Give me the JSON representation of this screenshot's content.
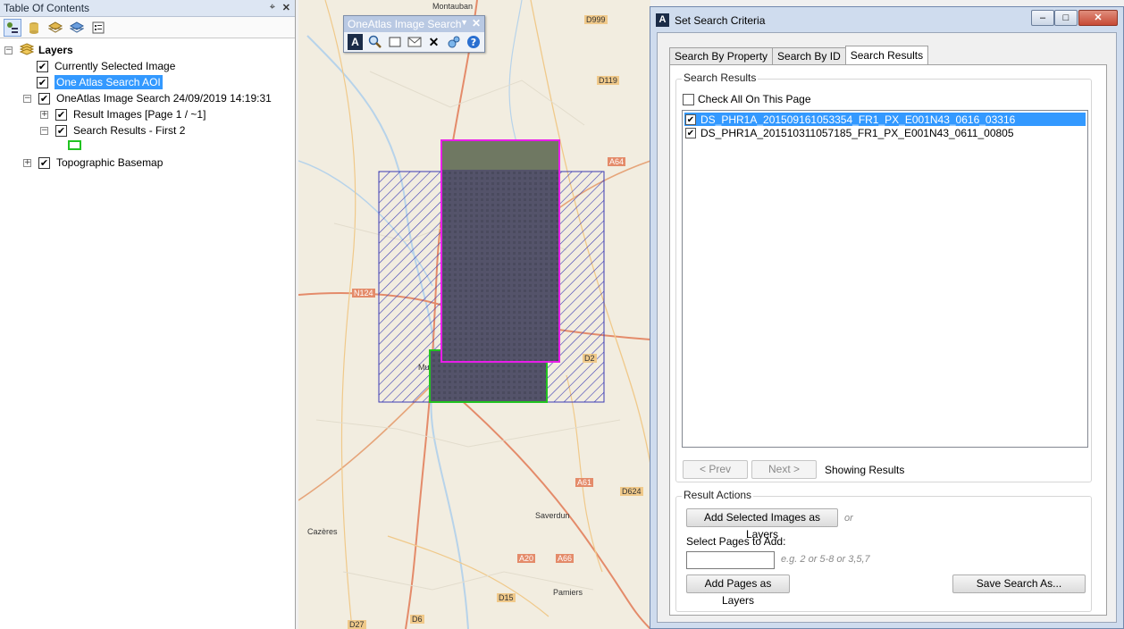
{
  "toc": {
    "title": "Table Of Contents",
    "layers_root": "Layers",
    "items": [
      {
        "label": "Currently Selected Image",
        "checked": true
      },
      {
        "label": "One Atlas Search AOI",
        "checked": true,
        "selected": true
      },
      {
        "label": "OneAtlas Image Search 24/09/2019 14:19:31",
        "checked": true
      },
      {
        "label": "Result Images [Page 1 / ~1]",
        "checked": true
      },
      {
        "label": "Search Results - First 2",
        "checked": true
      },
      {
        "label": "Topographic Basemap",
        "checked": true
      }
    ]
  },
  "map": {
    "labels": [
      "Montauban",
      "Saverdun",
      "Cazères",
      "Pamiers",
      "Mu",
      "N124",
      "A64",
      "A61",
      "A66",
      "D624",
      "D119",
      "D15",
      "D6",
      "D27",
      "D999",
      "D2",
      "A20"
    ],
    "toolbar_title": "OneAtlas Image Search",
    "colors": {
      "selected_outline": "#e81ee8",
      "result_outline": "#21c321",
      "aoi_hatch": "#3c3cb4"
    }
  },
  "dialog": {
    "title": "Set Search Criteria",
    "tabs": [
      "Search By Property",
      "Search By ID",
      "Search Results"
    ],
    "active_tab": "Search Results",
    "search_results_group": "Search Results",
    "check_all_label": "Check All On This Page",
    "results": [
      {
        "name": "DS_PHR1A_201509161053354_FR1_PX_E001N43_0616_03316",
        "checked": true,
        "selected": true
      },
      {
        "name": "DS_PHR1A_201510311057185_FR1_PX_E001N43_0611_00805",
        "checked": true,
        "selected": false
      }
    ],
    "prev_label": "< Prev",
    "next_label": "Next >",
    "showing_label": "Showing Results",
    "result_actions_group": "Result Actions",
    "add_selected_label": "Add Selected Images as Layers",
    "or_label": "or",
    "select_pages_label": "Select Pages to Add:",
    "pages_input_value": "",
    "pages_hint": "e.g. 2 or 5-8 or 3,5,7",
    "add_pages_label": "Add Pages as Layers",
    "save_search_label": "Save Search As..."
  }
}
